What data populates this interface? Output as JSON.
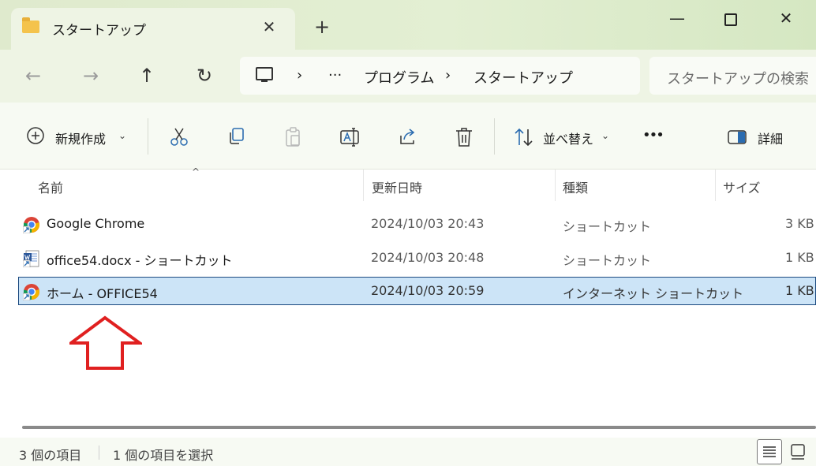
{
  "tab": {
    "title": "スタートアップ",
    "close": "✕",
    "new": "+"
  },
  "window_controls": {
    "minimize": "—",
    "close": "✕"
  },
  "nav": {
    "back": "←",
    "forward": "→",
    "up": "↑",
    "refresh": "↻",
    "address": {
      "chevron1": "›",
      "ellipsis": "···",
      "crumb1": "プログラム",
      "chevron2": "›",
      "crumb2": "スタートアップ"
    },
    "search_placeholder": "スタートアップの検索"
  },
  "toolbar": {
    "new_label": "新規作成",
    "sort_label": "並べ替え",
    "more": "•••",
    "details_label": "詳細"
  },
  "columns": {
    "name": "名前",
    "date": "更新日時",
    "type": "種類",
    "size": "サイズ"
  },
  "files": [
    {
      "name": "Google Chrome",
      "date": "2024/10/03 20:43",
      "type": "ショートカット",
      "size": "3 KB",
      "icon": "chrome-shortcut-icon"
    },
    {
      "name": "office54.docx - ショートカット",
      "date": "2024/10/03 20:48",
      "type": "ショートカット",
      "size": "1 KB",
      "icon": "word-shortcut-icon"
    },
    {
      "name": "ホーム - OFFICE54",
      "date": "2024/10/03 20:59",
      "type": "インターネット ショートカット",
      "size": "1 KB",
      "icon": "chrome-shortcut-icon",
      "selected": true
    }
  ],
  "status": {
    "item_count": "3 個の項目",
    "selected_count": "1 個の項目を選択"
  },
  "colors": {
    "selection": "#cce4f7",
    "selection_border": "#1c4a80",
    "arrow": "#e02020",
    "folder": "#f4c34c"
  }
}
